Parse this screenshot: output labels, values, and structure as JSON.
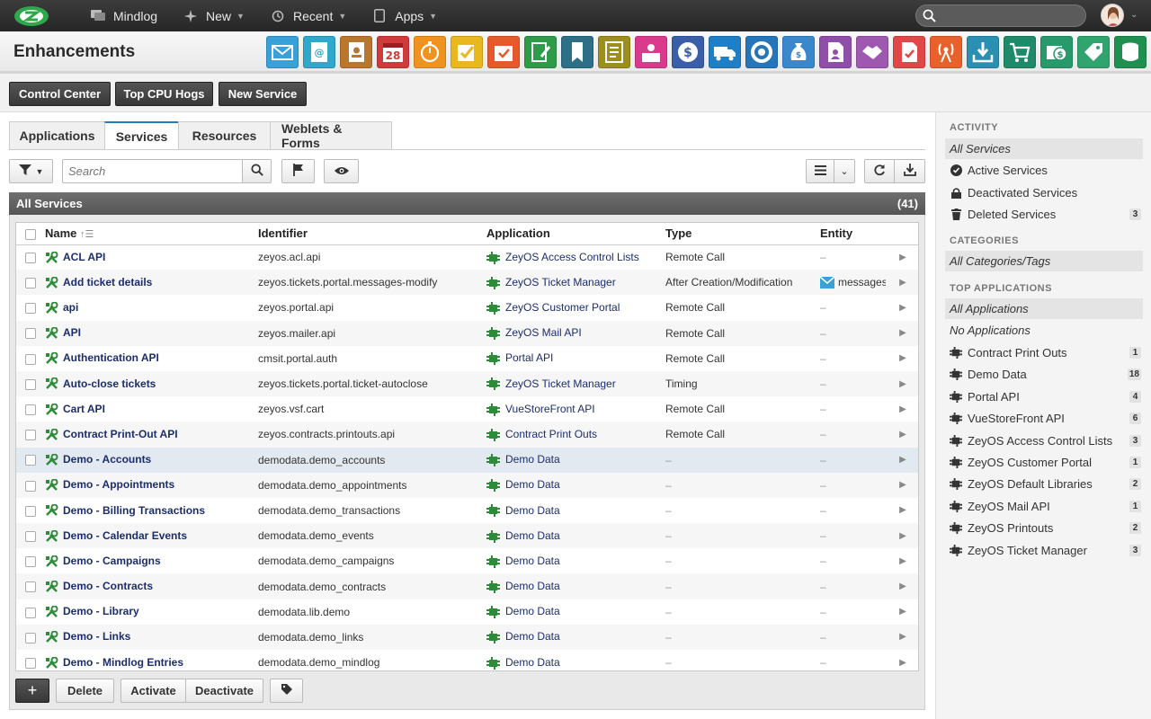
{
  "topbar": {
    "nav": [
      {
        "label": "Mindlog",
        "icon": "chat-icon",
        "dropdown": false
      },
      {
        "label": "New",
        "icon": "sparkle-icon",
        "dropdown": true
      },
      {
        "label": "Recent",
        "icon": "history-icon",
        "dropdown": true
      },
      {
        "label": "Apps",
        "icon": "tablet-icon",
        "dropdown": true
      }
    ],
    "search_placeholder": ""
  },
  "header": {
    "title": "Enhancements",
    "app_icons": [
      {
        "name": "mail-app-icon",
        "color": "#3aa0d8"
      },
      {
        "name": "email-app-icon",
        "color": "#2fa8c9"
      },
      {
        "name": "contacts-app-icon",
        "color": "#b8772d"
      },
      {
        "name": "calendar-app-icon",
        "color": "#d13a3a",
        "text": "28"
      },
      {
        "name": "timer-app-icon",
        "color": "#f0931e"
      },
      {
        "name": "tasks-app-icon",
        "color": "#e8b81e"
      },
      {
        "name": "projects-app-icon",
        "color": "#e55a2b"
      },
      {
        "name": "notes-app-icon",
        "color": "#2e9a4a"
      },
      {
        "name": "bookmarks-app-icon",
        "color": "#2d6f86"
      },
      {
        "name": "documents-app-icon",
        "color": "#9c8f1e"
      },
      {
        "name": "service-desk-app-icon",
        "color": "#d93a8c"
      },
      {
        "name": "billing-app-icon",
        "color": "#3a5fa8"
      },
      {
        "name": "delivery-app-icon",
        "color": "#1f7fc6"
      },
      {
        "name": "support-app-icon",
        "color": "#2575b8"
      },
      {
        "name": "finance-app-icon",
        "color": "#3a87cc"
      },
      {
        "name": "recruiting-app-icon",
        "color": "#8f4fa8"
      },
      {
        "name": "deals-app-icon",
        "color": "#9f58b0"
      },
      {
        "name": "pdf-app-icon",
        "color": "#e04848"
      },
      {
        "name": "broadcast-app-icon",
        "color": "#e8612b"
      },
      {
        "name": "download-app-icon",
        "color": "#2a8fb0"
      },
      {
        "name": "shop-app-icon",
        "color": "#1f8a6a"
      },
      {
        "name": "cash-app-icon",
        "color": "#27996b"
      },
      {
        "name": "pricing-app-icon",
        "color": "#2fa46e"
      },
      {
        "name": "database-app-icon",
        "color": "#1f9050"
      }
    ]
  },
  "actions": {
    "control_center": "Control Center",
    "top_cpu_hogs": "Top CPU Hogs",
    "new_service": "New Service"
  },
  "tabs": [
    "Applications",
    "Services",
    "Resources",
    "Weblets & Forms"
  ],
  "active_tab": "Services",
  "toolbar": {
    "search_placeholder": "Search"
  },
  "panel": {
    "title": "All Services",
    "count": "(41)"
  },
  "table": {
    "columns": [
      "Name",
      "Identifier",
      "Application",
      "Type",
      "Entity"
    ],
    "rows": [
      {
        "name": "ACL API",
        "identifier": "zeyos.acl.api",
        "application": "ZeyOS Access Control Lists",
        "type": "Remote Call",
        "entity": "–"
      },
      {
        "name": "Add ticket details",
        "identifier": "zeyos.tickets.portal.messages-modify",
        "application": "ZeyOS Ticket Manager",
        "type": "After Creation/Modification",
        "entity": "messages"
      },
      {
        "name": "api",
        "identifier": "zeyos.portal.api",
        "application": "ZeyOS Customer Portal",
        "type": "Remote Call",
        "entity": "–"
      },
      {
        "name": "API",
        "identifier": "zeyos.mailer.api",
        "application": "ZeyOS Mail API",
        "type": "Remote Call",
        "entity": "–"
      },
      {
        "name": "Authentication API",
        "identifier": "cmsit.portal.auth",
        "application": "Portal API",
        "type": "Remote Call",
        "entity": "–"
      },
      {
        "name": "Auto-close tickets",
        "identifier": "zeyos.tickets.portal.ticket-autoclose",
        "application": "ZeyOS Ticket Manager",
        "type": "Timing",
        "entity": "–"
      },
      {
        "name": "Cart API",
        "identifier": "zeyos.vsf.cart",
        "application": "VueStoreFront API",
        "type": "Remote Call",
        "entity": "–"
      },
      {
        "name": "Contract Print-Out API",
        "identifier": "zeyos.contracts.printouts.api",
        "application": "Contract Print Outs",
        "type": "Remote Call",
        "entity": "–"
      },
      {
        "name": "Demo - Accounts",
        "identifier": "demodata.demo_accounts",
        "application": "Demo Data",
        "type": "–",
        "entity": "–"
      },
      {
        "name": "Demo - Appointments",
        "identifier": "demodata.demo_appointments",
        "application": "Demo Data",
        "type": "–",
        "entity": "–"
      },
      {
        "name": "Demo - Billing Transactions",
        "identifier": "demodata.demo_transactions",
        "application": "Demo Data",
        "type": "–",
        "entity": "–"
      },
      {
        "name": "Demo - Calendar Events",
        "identifier": "demodata.demo_events",
        "application": "Demo Data",
        "type": "–",
        "entity": "–"
      },
      {
        "name": "Demo - Campaigns",
        "identifier": "demodata.demo_campaigns",
        "application": "Demo Data",
        "type": "–",
        "entity": "–"
      },
      {
        "name": "Demo - Contracts",
        "identifier": "demodata.demo_contracts",
        "application": "Demo Data",
        "type": "–",
        "entity": "–"
      },
      {
        "name": "Demo - Library",
        "identifier": "demodata.lib.demo",
        "application": "Demo Data",
        "type": "–",
        "entity": "–"
      },
      {
        "name": "Demo - Links",
        "identifier": "demodata.demo_links",
        "application": "Demo Data",
        "type": "–",
        "entity": "–"
      },
      {
        "name": "Demo - Mindlog Entries",
        "identifier": "demodata.demo_mindlog",
        "application": "Demo Data",
        "type": "–",
        "entity": "–"
      }
    ]
  },
  "bottom": {
    "add": "+",
    "delete": "Delete",
    "activate": "Activate",
    "deactivate": "Deactivate"
  },
  "sidebar": {
    "activity_head": "ACTIVITY",
    "activity": [
      {
        "label": "All Services",
        "icon": "",
        "count": ""
      },
      {
        "label": "Active Services",
        "icon": "check-circle-icon",
        "count": ""
      },
      {
        "label": "Deactivated Services",
        "icon": "lock-icon",
        "count": ""
      },
      {
        "label": "Deleted Services",
        "icon": "trash-icon",
        "count": "3"
      }
    ],
    "categories_head": "CATEGORIES",
    "categories": [
      {
        "label": "All Categories/Tags"
      }
    ],
    "apps_head": "TOP APPLICATIONS",
    "apps_static": [
      {
        "label": "All Applications"
      },
      {
        "label": "No Applications"
      }
    ],
    "apps": [
      {
        "label": "Contract Print Outs",
        "count": "1"
      },
      {
        "label": "Demo Data",
        "count": "18"
      },
      {
        "label": "Portal API",
        "count": "4"
      },
      {
        "label": "VueStoreFront API",
        "count": "6"
      },
      {
        "label": "ZeyOS Access Control Lists",
        "count": "3"
      },
      {
        "label": "ZeyOS Customer Portal",
        "count": "1"
      },
      {
        "label": "ZeyOS Default Libraries",
        "count": "2"
      },
      {
        "label": "ZeyOS Mail API",
        "count": "1"
      },
      {
        "label": "ZeyOS Printouts",
        "count": "2"
      },
      {
        "label": "ZeyOS Ticket Manager",
        "count": "3"
      }
    ]
  }
}
